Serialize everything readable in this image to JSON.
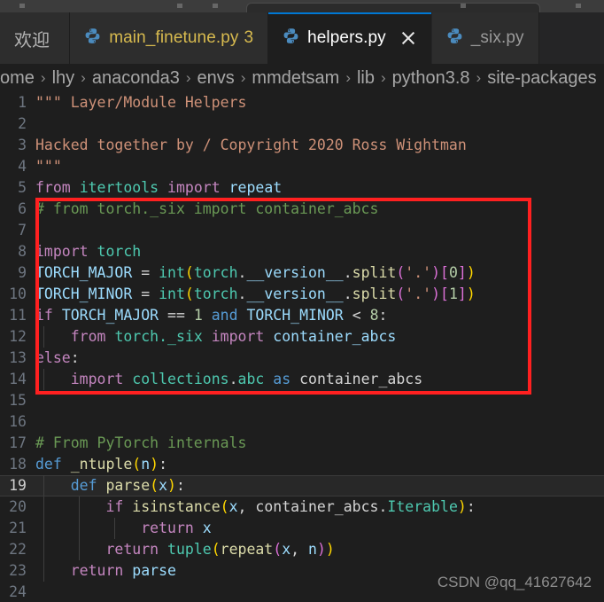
{
  "window": {
    "titlebar_search_placeholder": ""
  },
  "tabs": [
    {
      "label": "欢迎",
      "icon": "none",
      "dirty": false,
      "active": false,
      "badge": "",
      "closable": false
    },
    {
      "label": "main_finetune.py",
      "icon": "python-icon",
      "dirty": true,
      "active": false,
      "badge": "3",
      "closable": false
    },
    {
      "label": "helpers.py",
      "icon": "python-icon",
      "dirty": false,
      "active": true,
      "badge": "",
      "closable": true
    },
    {
      "label": "_six.py",
      "icon": "python-icon",
      "dirty": false,
      "active": false,
      "badge": "",
      "closable": false
    }
  ],
  "breadcrumb": {
    "separator": "›",
    "items": [
      "ome",
      "lhy",
      "anaconda3",
      "envs",
      "mmdetsam",
      "lib",
      "python3.8",
      "site-packages"
    ]
  },
  "editor": {
    "language": "python",
    "active_line": 19,
    "colors": {
      "background": "#1e1e1e",
      "comment": "#6a9955",
      "string": "#ce9178",
      "keyword": "#c586c0",
      "keyword_blue": "#569cd6",
      "variable": "#9cdcfe",
      "type": "#4ec9b0",
      "function": "#dcdcaa",
      "number": "#b5cea8",
      "accent_tab": "#0078d4",
      "annotation_box": "#ff2020"
    },
    "lines": [
      {
        "n": 1,
        "text": "    \"\"\" Layer/Module Helpers"
      },
      {
        "n": 2,
        "text": ""
      },
      {
        "n": 3,
        "text": "    Hacked together by / Copyright 2020 Ross Wightman"
      },
      {
        "n": 4,
        "text": "    \"\"\""
      },
      {
        "n": 5,
        "text": "    from itertools import repeat"
      },
      {
        "n": 6,
        "text": "    # from torch._six import container_abcs"
      },
      {
        "n": 7,
        "text": ""
      },
      {
        "n": 8,
        "text": "    import torch"
      },
      {
        "n": 9,
        "text": "    TORCH_MAJOR = int(torch.__version__.split('.')[0])"
      },
      {
        "n": 10,
        "text": "    TORCH_MINOR = int(torch.__version__.split('.')[1])"
      },
      {
        "n": 11,
        "text": "    if TORCH_MAJOR == 1 and TORCH_MINOR < 8:"
      },
      {
        "n": 12,
        "text": "        from torch._six import container_abcs"
      },
      {
        "n": 13,
        "text": "    else:"
      },
      {
        "n": 14,
        "text": "        import collections.abc as container_abcs"
      },
      {
        "n": 15,
        "text": ""
      },
      {
        "n": 16,
        "text": ""
      },
      {
        "n": 17,
        "text": "    # From PyTorch internals"
      },
      {
        "n": 18,
        "text": "    def _ntuple(n):"
      },
      {
        "n": 19,
        "text": "        def parse(x):"
      },
      {
        "n": 20,
        "text": "            if isinstance(x, container_abcs.Iterable):"
      },
      {
        "n": 21,
        "text": "                return x"
      },
      {
        "n": 22,
        "text": "            return tuple(repeat(x, n))"
      },
      {
        "n": 23,
        "text": "        return parse"
      },
      {
        "n": 24,
        "text": ""
      }
    ]
  },
  "annotation": {
    "type": "red-rectangle",
    "covers_lines": "6-14",
    "color": "#ff2020"
  },
  "watermark": {
    "text": "CSDN @qq_41627642"
  }
}
